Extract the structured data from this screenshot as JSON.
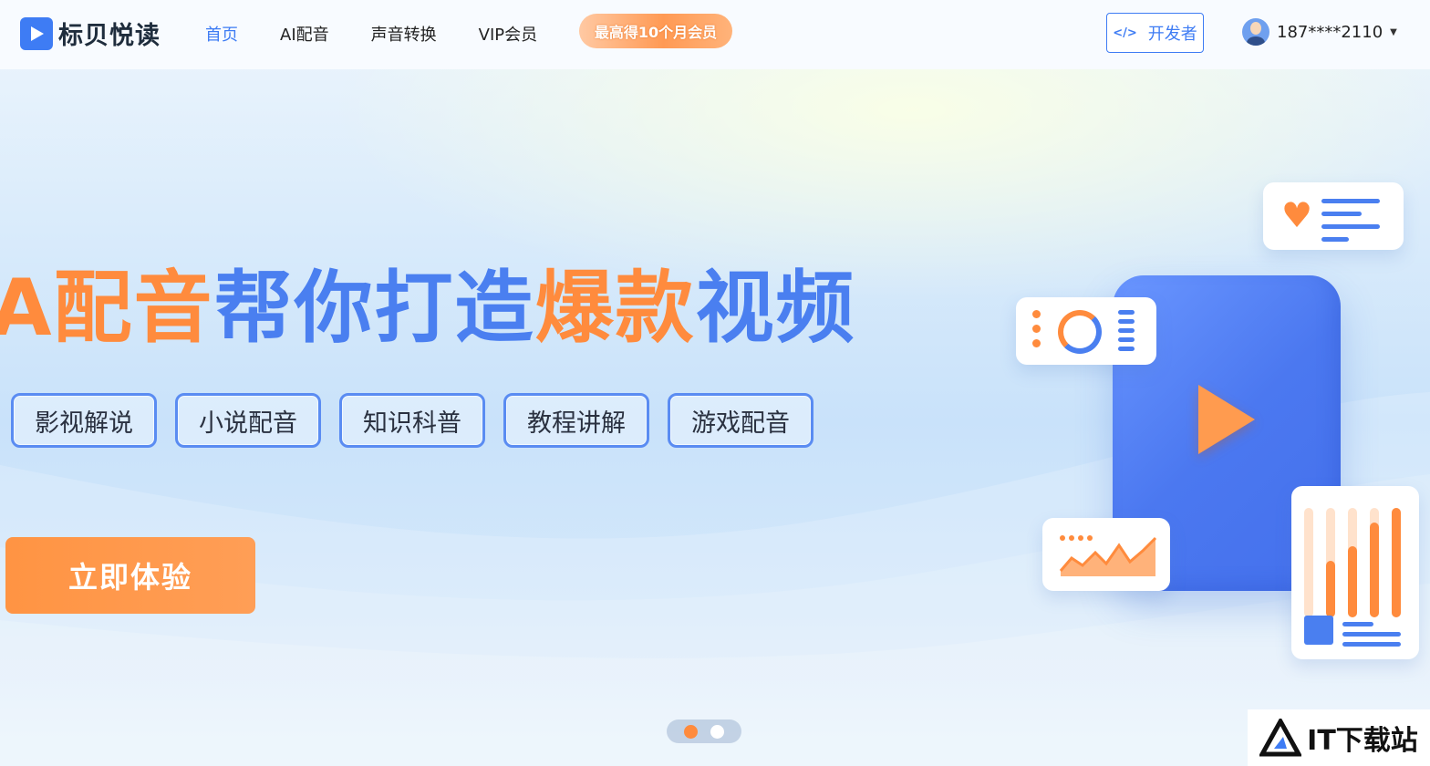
{
  "header": {
    "logo_text": "标贝悦读",
    "nav": [
      {
        "label": "首页",
        "active": true
      },
      {
        "label": "AI配音",
        "active": false
      },
      {
        "label": "声音转换",
        "active": false
      },
      {
        "label": "VIP会员",
        "active": false
      }
    ],
    "promo_label": "最高得10个月会员",
    "developer_button": "开发者",
    "user_phone": "187****2110"
  },
  "hero": {
    "headline_parts": [
      {
        "text": "A配音",
        "color": "orange"
      },
      {
        "text": "帮你打造",
        "color": "blue"
      },
      {
        "text": "爆款",
        "color": "orange"
      },
      {
        "text": "视频",
        "color": "blue"
      }
    ],
    "tags": [
      "影视解说",
      "小说配音",
      "知识科普",
      "教程讲解",
      "游戏配音"
    ],
    "cta_label": "立即体验"
  },
  "carousel": {
    "slides": 2,
    "active_index": 0
  },
  "watermark": {
    "text": "IT下载站"
  },
  "colors": {
    "brand_blue": "#3e7cf4",
    "accent_orange": "#ff8b3d"
  }
}
